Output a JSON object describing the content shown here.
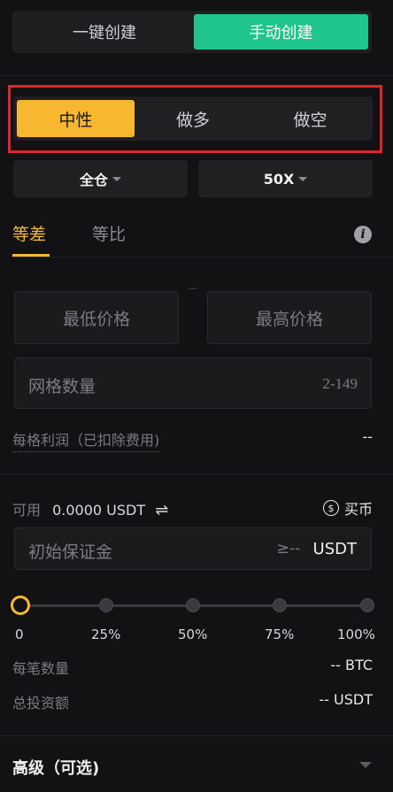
{
  "mode_tabs": {
    "auto": "一键创建",
    "manual": "手动创建"
  },
  "direction": {
    "neutral": "中性",
    "long": "做多",
    "short": "做空"
  },
  "margin_mode": "全仓",
  "leverage": "50X",
  "grid_type_tabs": {
    "arithmetic": "等差",
    "geometric": "等比"
  },
  "info_icon": "info-icon",
  "price_inputs": {
    "min_placeholder": "最低价格",
    "max_placeholder": "最高价格"
  },
  "grid_count": {
    "placeholder": "网格数量",
    "range": "2-149"
  },
  "profit_per_grid": {
    "label": "每格利润（已扣除费用)",
    "value": "--"
  },
  "available": {
    "label": "可用",
    "value": "0.0000 USDT",
    "swap_icon": "⇌"
  },
  "buy_coin": {
    "icon": "$",
    "label": "买币"
  },
  "initial_margin": {
    "placeholder": "初始保证金",
    "min": "≥--",
    "unit": "USDT"
  },
  "slider": {
    "value_percent": 0,
    "marks": [
      "0",
      "25%",
      "50%",
      "75%",
      "100%"
    ]
  },
  "per_order_qty": {
    "label": "每笔数量",
    "value": "-- BTC"
  },
  "total_investment": {
    "label": "总投资额",
    "value": "-- USDT"
  },
  "advanced": {
    "label": "高级（可选)"
  },
  "colors": {
    "accent_green": "#1fc58c",
    "accent_orange": "#f7b731",
    "highlight_red": "#e0262d"
  }
}
